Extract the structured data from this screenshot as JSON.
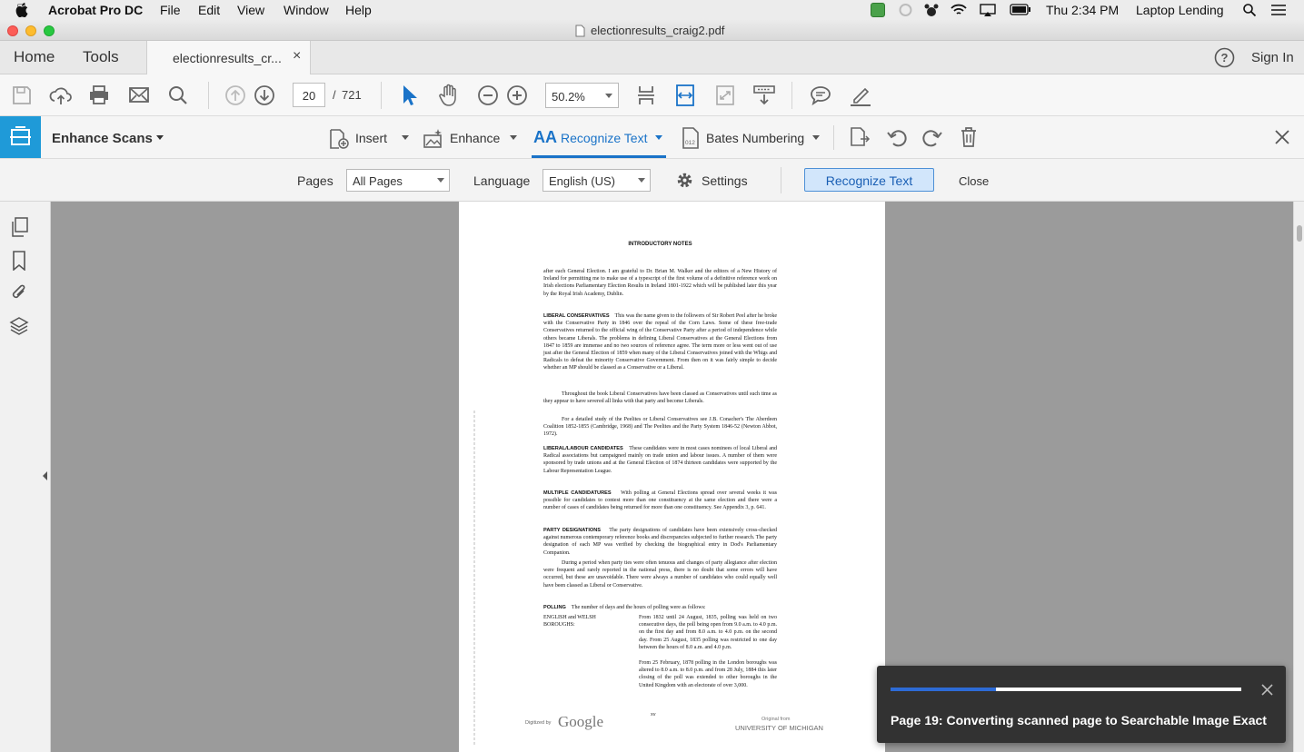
{
  "menubar": {
    "app": "Acrobat Pro DC",
    "items": [
      "File",
      "Edit",
      "View",
      "Window",
      "Help"
    ],
    "clock": "Thu 2:34 PM",
    "user": "Laptop Lending"
  },
  "window": {
    "title": "electionresults_craig2.pdf"
  },
  "tabs": {
    "home": "Home",
    "tools": "Tools",
    "doc_tab": "electionresults_cr...",
    "sign_in": "Sign In"
  },
  "toolbar": {
    "page_current": "20",
    "page_sep": "/",
    "page_total": "721",
    "zoom": "50.2%"
  },
  "enhance_bar": {
    "title": "Enhance Scans",
    "insert": "Insert",
    "enhance": "Enhance",
    "recognize": "Recognize Text",
    "bates": "Bates Numbering"
  },
  "recognize_bar": {
    "pages_label": "Pages",
    "pages_value": "All Pages",
    "language_label": "Language",
    "language_value": "English (US)",
    "settings": "Settings",
    "recognize_button": "Recognize Text",
    "close": "Close"
  },
  "document": {
    "heading": "INTRODUCTORY NOTES",
    "p1": "after each General Election. I am grateful to Dr. Brian M. Walker and the editors of a New History of Ireland for permitting me to make use of a typescript of the first volume of a definitive reference work on Irish elections Parliamentary Election Results in Ireland 1801-1922 which will be published later this year by the Royal Irish Academy, Dublin.",
    "h2": "LIBERAL CONSERVATIVES",
    "p2": "This was the name given to the followers of Sir Robert Peel after he broke with the Conservative Party in 1846 over the repeal of the Corn Laws. Some of these free-trade Conservatives returned to the official wing of the Conservative Party after a period of independence while others became Liberals. The problems in defining Liberal Conservatives at the General Elections from 1847 to 1859 are immense and no two sources of reference agree. The term more or less went out of use just after the General Election of 1859 when many of the Liberal Conservatives joined with the Whigs and Radicals to defeat the minority Conservative Government. From then on it was fairly simple to decide whether an MP should be classed as a Conservative or a Liberal.",
    "p3": "Throughout the book Liberal Conservatives have been classed as Conservatives until such time as they appear to have severed all links with that party and become Liberals.",
    "p4": "For a detailed study of the Peelites or Liberal Conservatives see J.B. Conacher's The Aberdeen Coalition 1852-1855 (Cambridge, 1968) and The Peelites and the Party System 1846-52 (Newton Abbot, 1972).",
    "h5": "LIBERAL/LABOUR CANDIDATES",
    "p5": "These candidates were in most cases nominees of local Liberal and Radical associations but campaigned mainly on trade union and labour issues. A number of them were sponsored by trade unions and at the General Election of 1874 thirteen candidates were supported by the Labour Representation League.",
    "h6": "MULTIPLE CANDIDATURES",
    "p6": "With polling at General Elections spread over several weeks it was possible for candidates to contest more than one constituency at the same election and there were a number of cases of candidates being returned for more than one constituency. See Appendix 3, p. 641.",
    "h7": "PARTY DESIGNATIONS",
    "p7": "The party designations of candidates have been extensively cross-checked against numerous contemporary reference books and discrepancies subjected to further research. The party designation of each MP was verified by checking the biographical entry in Dod's Parliamentary Companion.",
    "p8": "During a period when party ties were often tenuous and changes of party allegiance after election were frequent and rarely reported in the national press, there is no doubt that some errors will have occurred, but these are unavoidable. There were always a number of candidates who could equally well have been classed as Liberal or Conservative.",
    "h9": "POLLING",
    "p9": "The number of days and the hours of polling were as follows:",
    "left10": "ENGLISH and WELSH BOROUGHS:",
    "right10": "From 1832 until 24 August, 1835, polling was held on two consecutive days, the poll being open from 9.0 a.m. to 4.0 p.m. on the first day and from 8.0 a.m. to 4.0 p.m. on the second day. From 25 August, 1835 polling was restricted to one day between the hours of 8.0 a.m. and 4.0 p.m.",
    "right11": "From 25 February, 1878 polling in the London boroughs was altered to 8.0 a.m. to 8.0 p.m. and from 28 July, 1884 this later closing of the poll was extended to other boroughs in the United Kingdom with an electorate of over 3,000.",
    "digitized": "Digitized by",
    "google": "Google",
    "page_num": "xv",
    "original_from": "Original from",
    "university": "UNIVERSITY OF MICHIGAN"
  },
  "toast": {
    "progress": 0.3,
    "message": "Page 19: Converting scanned page to Searchable Image Exact"
  }
}
